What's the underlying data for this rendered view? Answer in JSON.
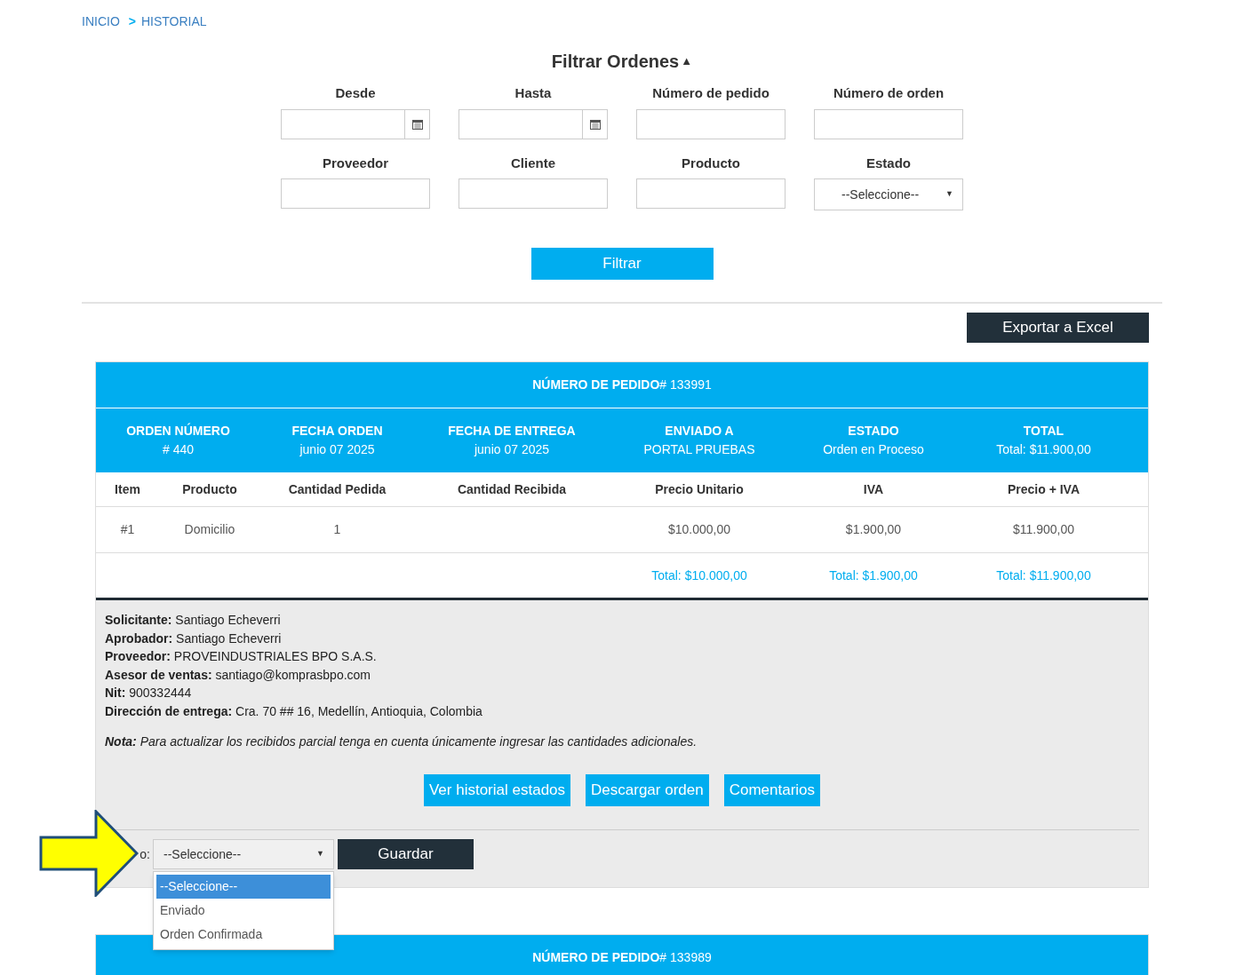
{
  "breadcrumb": [
    {
      "label": "INICIO"
    },
    {
      "separator": ">",
      "label": "HISTORIAL"
    }
  ],
  "filter": {
    "title": "Filtrar Ordenes",
    "toggle": "▲",
    "expanded": true,
    "fields": [
      {
        "kind": "date",
        "label": "Desde"
      },
      {
        "kind": "date",
        "label": "Hasta"
      },
      {
        "kind": "text",
        "label": "Número de pedido"
      },
      {
        "kind": "text",
        "label": "Número de orden"
      },
      {
        "kind": "text",
        "label": "Proveedor"
      },
      {
        "kind": "text",
        "label": "Cliente"
      },
      {
        "kind": "text",
        "label": "Producto"
      },
      {
        "kind": "select",
        "label": "Estado",
        "value": "--Seleccione--",
        "caret": "▼"
      }
    ],
    "button": "Filtrar"
  },
  "export_button": "Exportar a Excel",
  "orders": [
    {
      "header_label": "NÚMERO DE PEDIDO",
      "header_value": "# 133991",
      "summary": [
        {
          "label": "ORDEN NÚMERO",
          "value": "# 440"
        },
        {
          "label": "FECHA ORDEN",
          "value": "junio 07 2025"
        },
        {
          "label": "FECHA DE ENTREGA",
          "value": "junio 07 2025"
        },
        {
          "label": "ENVIADO A",
          "value": "PORTAL PRUEBAS"
        },
        {
          "label": "ESTADO",
          "value": "Orden en Proceso"
        },
        {
          "label": "TOTAL",
          "value": "Total: $11.900,00"
        }
      ],
      "columns": [
        "Item",
        "Producto",
        "Cantidad Pedida",
        "Cantidad Recibida",
        "Precio Unitario",
        "IVA",
        "Precio + IVA"
      ],
      "rows": [
        [
          "#1",
          "Domicilio",
          "1",
          "",
          "$10.000,00",
          "$1.900,00",
          "$11.900,00"
        ]
      ],
      "totals": [
        "Total: $10.000,00",
        "Total: $1.900,00",
        "Total: $11.900,00"
      ],
      "details": [
        "**Solicitante:** Santiago Echeverri",
        "**Aprobador:** Santiago Echeverri",
        "**Proveedor:** PROVEINDUSTRIALES BPO S.A.S.",
        "**Asesor de ventas:** santiago@komprasbpo.com",
        "**Nit:** 900332444",
        "**Dirección de entrega:** Cra. 70 ## 16, Medellín, Antioquia, Colombia"
      ],
      "note": "**Nota:** Para actualizar los recibidos parcial tenga en cuenta únicamente ingresar las cantidades adicionales.",
      "actions": [
        "Ver historial estados",
        "Descargar orden",
        "Comentarios"
      ],
      "status": {
        "label": "o:",
        "value": "--Seleccione--",
        "caret": "▼",
        "open": true,
        "options": [
          {
            "label": "--Seleccione--",
            "selected": true
          },
          {
            "label": "Enviado",
            "selected": false
          },
          {
            "label": "Orden Confirmada",
            "selected": false
          }
        ],
        "button": "Guardar"
      }
    },
    {
      "header_label": "NÚMERO DE PEDIDO",
      "header_value": "# 133989"
    }
  ],
  "callout_arrow": true
}
